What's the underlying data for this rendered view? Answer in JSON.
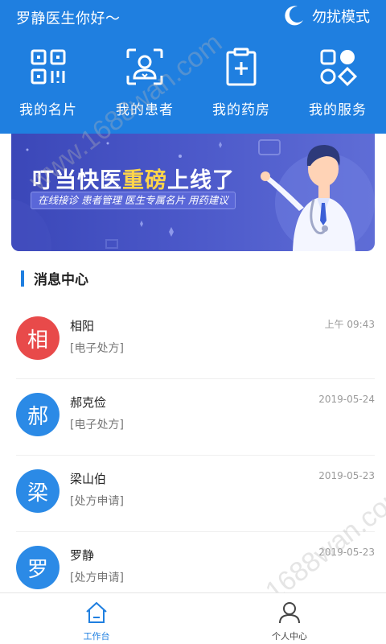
{
  "header": {
    "greeting": "罗静医生你好～",
    "dnd_label": "勿扰模式",
    "quick_actions": [
      {
        "label": "我的名片",
        "icon": "qr-code-icon"
      },
      {
        "label": "我的患者",
        "icon": "patient-icon"
      },
      {
        "label": "我的药房",
        "icon": "pharmacy-icon"
      },
      {
        "label": "我的服务",
        "icon": "services-icon"
      }
    ]
  },
  "banner": {
    "title_prefix": "叮当快医",
    "title_highlight": "重磅",
    "title_suffix": "上线了",
    "tagline": "在线接诊 患者管理 医生专属名片 用药建议"
  },
  "messages": {
    "section_title": "消息中心",
    "items": [
      {
        "initial": "相",
        "name": "相阳",
        "type": "[电子处方]",
        "time": "上午 09:43",
        "color": "#e84a4a"
      },
      {
        "initial": "郝",
        "name": "郝克俭",
        "type": "[电子处方]",
        "time": "2019-05-24",
        "color": "#2b8ae6"
      },
      {
        "initial": "梁",
        "name": "梁山伯",
        "type": "[处方申请]",
        "time": "2019-05-23",
        "color": "#2b8ae6"
      },
      {
        "initial": "罗",
        "name": "罗静",
        "type": "[处方申请]",
        "time": "2019-05-23",
        "color": "#2b8ae6"
      }
    ]
  },
  "tabbar": {
    "tabs": [
      {
        "label": "工作台",
        "icon": "home-icon",
        "active": true
      },
      {
        "label": "个人中心",
        "icon": "user-icon",
        "active": false
      }
    ]
  },
  "watermark": "www.1688wan.com",
  "colors": {
    "primary": "#1f7fe0",
    "highlight": "#ffd54a"
  }
}
